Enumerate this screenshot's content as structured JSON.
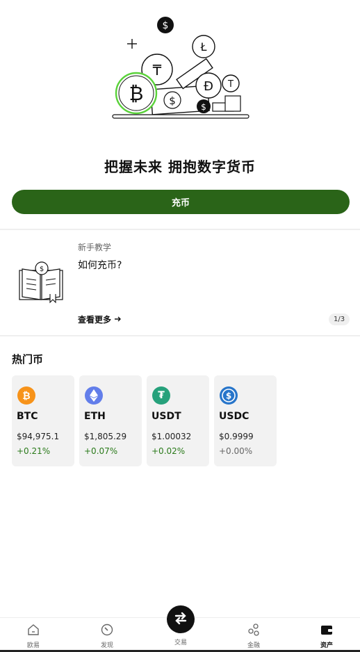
{
  "hero": {
    "headline": "把握未来 拥抱数字货币"
  },
  "deposit_button": {
    "label": "充币"
  },
  "tutorial": {
    "tag": "新手教学",
    "title": "如何充币?",
    "more_label": "查看更多",
    "page_indicator": "1/3"
  },
  "hot_coins": {
    "title": "热门币",
    "items": [
      {
        "symbol": "BTC",
        "price": "$94,975.1",
        "change": "+0.21%",
        "icon": "bitcoin-icon",
        "color": "#f7931a",
        "change_color": "#2a7a1a"
      },
      {
        "symbol": "ETH",
        "price": "$1,805.29",
        "change": "+0.07%",
        "icon": "ethereum-icon",
        "color": "#627eea",
        "change_color": "#2a7a1a"
      },
      {
        "symbol": "USDT",
        "price": "$1.00032",
        "change": "+0.02%",
        "icon": "tether-icon",
        "color": "#26a17b",
        "change_color": "#2a7a1a"
      },
      {
        "symbol": "USDC",
        "price": "$0.9999",
        "change": "+0.00%",
        "icon": "usdc-icon",
        "color": "#2775ca",
        "change_color": "#666666"
      }
    ]
  },
  "bottom_nav": {
    "items": [
      {
        "label": "欧易",
        "icon": "home-icon"
      },
      {
        "label": "发现",
        "icon": "discover-icon"
      },
      {
        "label": "交易",
        "icon": "trade-swap-icon"
      },
      {
        "label": "金融",
        "icon": "finance-icon"
      },
      {
        "label": "资产",
        "icon": "wallet-icon",
        "active": true
      }
    ]
  },
  "colors": {
    "accent": "#2a6418",
    "positive": "#2a7a1a",
    "neutral": "#666666"
  }
}
